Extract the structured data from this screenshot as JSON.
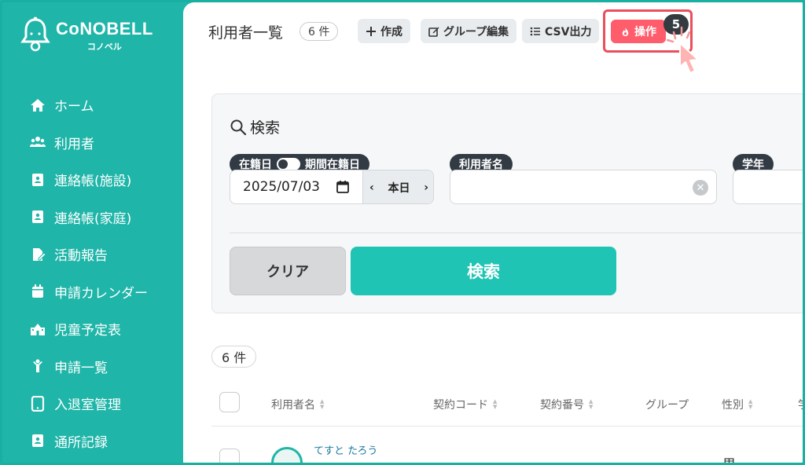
{
  "brand": {
    "name": "CoNOBELL",
    "sub": "コノベル"
  },
  "sidebar": {
    "items": [
      {
        "label": "ホーム",
        "icon": "home-icon"
      },
      {
        "label": "利用者",
        "icon": "users-icon"
      },
      {
        "label": "連絡帳(施設)",
        "icon": "contact-book-icon"
      },
      {
        "label": "連絡帳(家庭)",
        "icon": "contact-book-icon"
      },
      {
        "label": "活動報告",
        "icon": "report-edit-icon"
      },
      {
        "label": "申請カレンダー",
        "icon": "calendar-icon"
      },
      {
        "label": "児童予定表",
        "icon": "school-icon"
      },
      {
        "label": "申請一覧",
        "icon": "child-icon"
      },
      {
        "label": "入退室管理",
        "icon": "tablet-icon"
      },
      {
        "label": "通所記録",
        "icon": "contact-book-icon"
      }
    ]
  },
  "header": {
    "title": "利用者一覧",
    "count": "6 件",
    "create_label": "作成",
    "group_edit_label": "グループ編集",
    "csv_label": "CSV出力",
    "operation_label": "操作",
    "operation_badge": "5"
  },
  "search": {
    "title": "検索",
    "enrolled_day_label": "在籍日",
    "period_label": "期間在籍日",
    "date_value": "2025/07/03",
    "today_label": "本日",
    "name_label": "利用者名",
    "name_value": "",
    "grade_label": "学年",
    "clear_label": "クリア",
    "search_label": "検索"
  },
  "results": {
    "count": "6 件",
    "columns": [
      "利用者名",
      "契約コード",
      "契約番号",
      "グループ",
      "性別",
      "学"
    ],
    "rows": [
      {
        "name": "てすと たろう",
        "gender": "男"
      }
    ]
  },
  "colors": {
    "brand": "#1fb5a8",
    "accent_red": "#ff5c6c",
    "search_button": "#1fc4b4"
  }
}
